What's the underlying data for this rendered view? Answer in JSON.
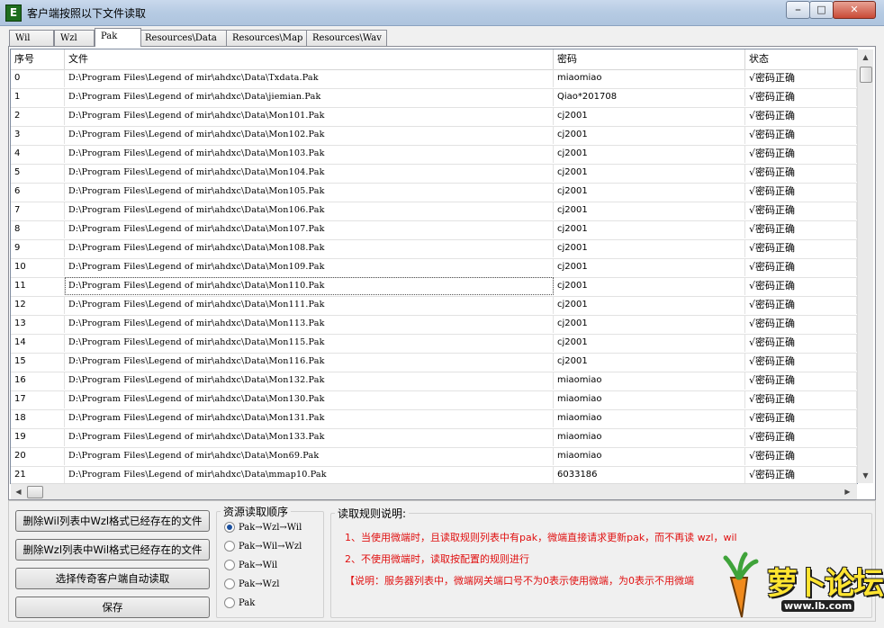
{
  "window": {
    "title": "客户端按照以下文件读取",
    "icon_letter": "E"
  },
  "tabs": [
    "Wil",
    "Wzl",
    "Pak",
    "Resources\\Data",
    "Resources\\Map",
    "Resources\\Wav"
  ],
  "active_tab": "Pak",
  "table": {
    "columns": [
      "序号",
      "文件",
      "密码",
      "状态"
    ],
    "rows": [
      [
        "0",
        "D:\\Program Files\\Legend of mir\\ahdxc\\Data\\Txdata.Pak",
        "miaomiao",
        "√密码正确"
      ],
      [
        "1",
        "D:\\Program Files\\Legend of mir\\ahdxc\\Data\\jiemian.Pak",
        "Qiao*201708",
        "√密码正确"
      ],
      [
        "2",
        "D:\\Program Files\\Legend of mir\\ahdxc\\Data\\Mon101.Pak",
        "cj2001",
        "√密码正确"
      ],
      [
        "3",
        "D:\\Program Files\\Legend of mir\\ahdxc\\Data\\Mon102.Pak",
        "cj2001",
        "√密码正确"
      ],
      [
        "4",
        "D:\\Program Files\\Legend of mir\\ahdxc\\Data\\Mon103.Pak",
        "cj2001",
        "√密码正确"
      ],
      [
        "5",
        "D:\\Program Files\\Legend of mir\\ahdxc\\Data\\Mon104.Pak",
        "cj2001",
        "√密码正确"
      ],
      [
        "6",
        "D:\\Program Files\\Legend of mir\\ahdxc\\Data\\Mon105.Pak",
        "cj2001",
        "√密码正确"
      ],
      [
        "7",
        "D:\\Program Files\\Legend of mir\\ahdxc\\Data\\Mon106.Pak",
        "cj2001",
        "√密码正确"
      ],
      [
        "8",
        "D:\\Program Files\\Legend of mir\\ahdxc\\Data\\Mon107.Pak",
        "cj2001",
        "√密码正确"
      ],
      [
        "9",
        "D:\\Program Files\\Legend of mir\\ahdxc\\Data\\Mon108.Pak",
        "cj2001",
        "√密码正确"
      ],
      [
        "10",
        "D:\\Program Files\\Legend of mir\\ahdxc\\Data\\Mon109.Pak",
        "cj2001",
        "√密码正确"
      ],
      [
        "11",
        "D:\\Program Files\\Legend of mir\\ahdxc\\Data\\Mon110.Pak",
        "cj2001",
        "√密码正确"
      ],
      [
        "12",
        "D:\\Program Files\\Legend of mir\\ahdxc\\Data\\Mon111.Pak",
        "cj2001",
        "√密码正确"
      ],
      [
        "13",
        "D:\\Program Files\\Legend of mir\\ahdxc\\Data\\Mon113.Pak",
        "cj2001",
        "√密码正确"
      ],
      [
        "14",
        "D:\\Program Files\\Legend of mir\\ahdxc\\Data\\Mon115.Pak",
        "cj2001",
        "√密码正确"
      ],
      [
        "15",
        "D:\\Program Files\\Legend of mir\\ahdxc\\Data\\Mon116.Pak",
        "cj2001",
        "√密码正确"
      ],
      [
        "16",
        "D:\\Program Files\\Legend of mir\\ahdxc\\Data\\Mon132.Pak",
        "miaomiao",
        "√密码正确"
      ],
      [
        "17",
        "D:\\Program Files\\Legend of mir\\ahdxc\\Data\\Mon130.Pak",
        "miaomiao",
        "√密码正确"
      ],
      [
        "18",
        "D:\\Program Files\\Legend of mir\\ahdxc\\Data\\Mon131.Pak",
        "miaomiao",
        "√密码正确"
      ],
      [
        "19",
        "D:\\Program Files\\Legend of mir\\ahdxc\\Data\\Mon133.Pak",
        "miaomiao",
        "√密码正确"
      ],
      [
        "20",
        "D:\\Program Files\\Legend of mir\\ahdxc\\Data\\Mon69.Pak",
        "miaomiao",
        "√密码正确"
      ],
      [
        "21",
        "D:\\Program Files\\Legend of mir\\ahdxc\\Data\\mmap10.Pak",
        "6033186",
        "√密码正确"
      ]
    ],
    "focused_row": 11
  },
  "buttons": {
    "delete_wzl": "删除Wil列表中Wzl格式已经存在的文件",
    "delete_wil": "删除Wzl列表中Wil格式已经存在的文件",
    "auto_read": "选择传奇客户端自动读取",
    "save": "保存"
  },
  "order": {
    "title": "资源读取顺序",
    "options": [
      "Pak→Wzl→Wil",
      "Pak→Wil→Wzl",
      "Pak→Wil",
      "Pak→Wzl",
      "Pak"
    ],
    "selected": 0
  },
  "rules": {
    "title": "读取规则说明:",
    "lines": [
      "1、当使用微端时，且读取规则列表中有pak，微端直接请求更新pak，而不再读 wzl，wil",
      "2、不使用微端时，读取按配置的规则进行",
      "【说明：服务器列表中，微端网关端口号不为0表示使用微端，为0表示不用微端"
    ]
  },
  "watermark": {
    "text": "萝卜论坛",
    "url": "www.lb.com"
  },
  "colors": {
    "rule_text": "#e01010",
    "radio_selected": "#1a4f9e"
  }
}
